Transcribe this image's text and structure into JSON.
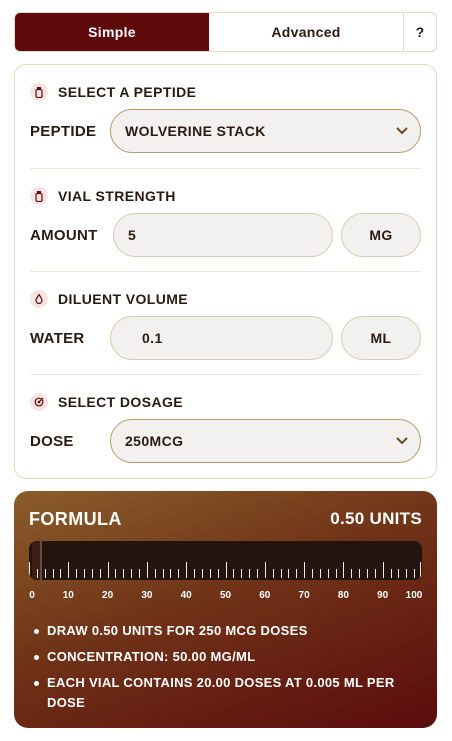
{
  "tabs": {
    "simple": "Simple",
    "advanced": "Advanced",
    "help": "?"
  },
  "peptide": {
    "title": "SELECT A PEPTIDE",
    "label": "PEPTIDE",
    "value": "WOLVERINE STACK"
  },
  "vial": {
    "title": "VIAL STRENGTH",
    "label": "AMOUNT",
    "value": "5",
    "unit": "MG"
  },
  "diluent": {
    "title": "DILUENT VOLUME",
    "label": "WATER",
    "value": "0.1",
    "unit": "ML"
  },
  "dosage": {
    "title": "SELECT DOSAGE",
    "label": "DOSE",
    "value": "250MCG"
  },
  "formula": {
    "title": "FORMULA",
    "units": "0.50 UNITS",
    "fill_units": 0.5,
    "scale": [
      "0",
      "10",
      "20",
      "30",
      "40",
      "50",
      "60",
      "70",
      "80",
      "90",
      "100"
    ],
    "notes": [
      "DRAW 0.50 UNITS FOR 250 MCG DOSES",
      "CONCENTRATION: 50.00 MG/ML",
      "EACH VIAL CONTAINS 20.00 DOSES AT 0.005 ML PER DOSE"
    ]
  },
  "colors": {
    "accent": "#5e0a0a",
    "border": "#d7ccb1",
    "field_bg": "#f2f1ef"
  },
  "icons": {
    "peptide": "vial-icon",
    "vial": "vial-icon",
    "diluent": "droplet-icon",
    "dosage": "target-icon",
    "select": "chevron-down-icon"
  }
}
